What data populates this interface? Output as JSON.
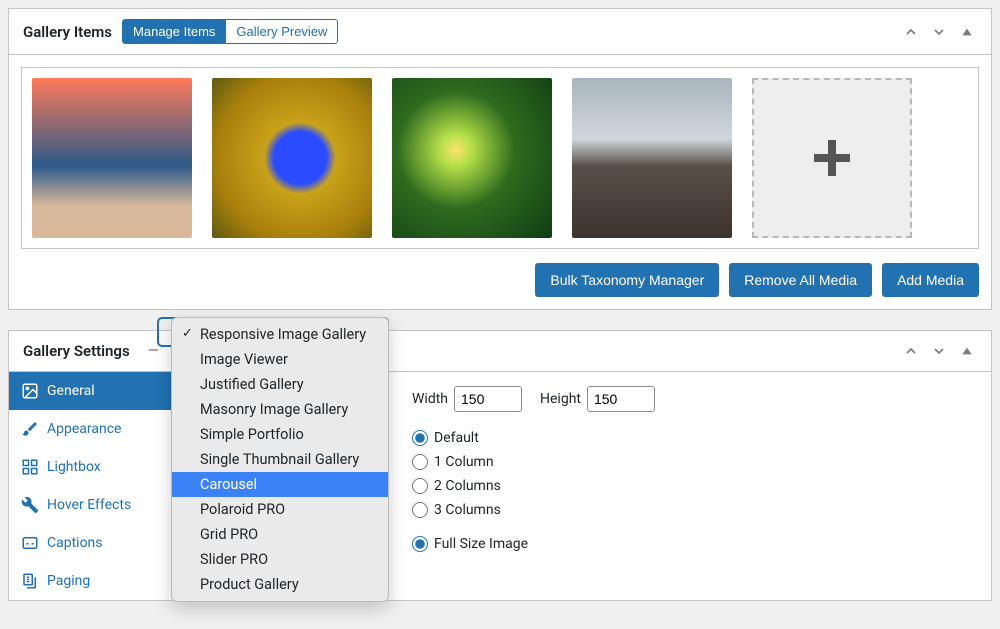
{
  "gallery_items": {
    "title": "Gallery Items",
    "tabs": {
      "manage": "Manage Items",
      "preview": "Gallery Preview"
    },
    "actions": {
      "bulk": "Bulk Taxonomy Manager",
      "remove_all": "Remove All Media",
      "add": "Add Media"
    }
  },
  "gallery_settings": {
    "title": "Gallery Settings",
    "sidebar": {
      "general": "General",
      "appearance": "Appearance",
      "lightbox": "Lightbox",
      "hover": "Hover Effects",
      "captions": "Captions",
      "paging": "Paging"
    },
    "fields": {
      "width_label": "Width",
      "width_value": "150",
      "height_label": "Height",
      "height_value": "150"
    },
    "layout_radios": {
      "default": "Default",
      "col1": "1 Column",
      "col2": "2 Columns",
      "col3": "3 Columns"
    },
    "size_radios": {
      "full": "Full Size Image"
    },
    "type_dropdown": {
      "options": [
        "Responsive Image Gallery",
        "Image Viewer",
        "Justified Gallery",
        "Masonry Image Gallery",
        "Simple Portfolio",
        "Single Thumbnail Gallery",
        "Carousel",
        "Polaroid PRO",
        "Grid PRO",
        "Slider PRO",
        "Product Gallery"
      ],
      "selected_index": 0,
      "highlighted_index": 6
    }
  }
}
